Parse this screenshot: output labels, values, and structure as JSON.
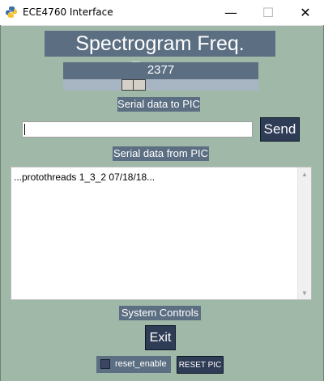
{
  "window": {
    "title": "ECE4760 Interface",
    "app_icon": "python-icon",
    "controls": {
      "minimize": "—",
      "maximize": "☐",
      "close": "✕"
    }
  },
  "main": {
    "title": "Spectrogram Freq. Range",
    "slider": {
      "value": "2377",
      "level": 0.38
    },
    "serial_to_pic": {
      "label": "Serial data to PIC",
      "input_value": "",
      "send_label": "Send"
    },
    "serial_from_pic": {
      "label": "Serial data from PIC",
      "output_text": "...protothreads 1_3_2 07/18/18..."
    },
    "system_controls": {
      "label": "System Controls",
      "exit_label": "Exit",
      "reset_enable_label": "reset_enable",
      "reset_pic_label": "RESET PIC"
    }
  },
  "colors": {
    "background": "#9fb8a8",
    "label_bg": "#5b6e82",
    "button_bg": "#2f3c56"
  }
}
